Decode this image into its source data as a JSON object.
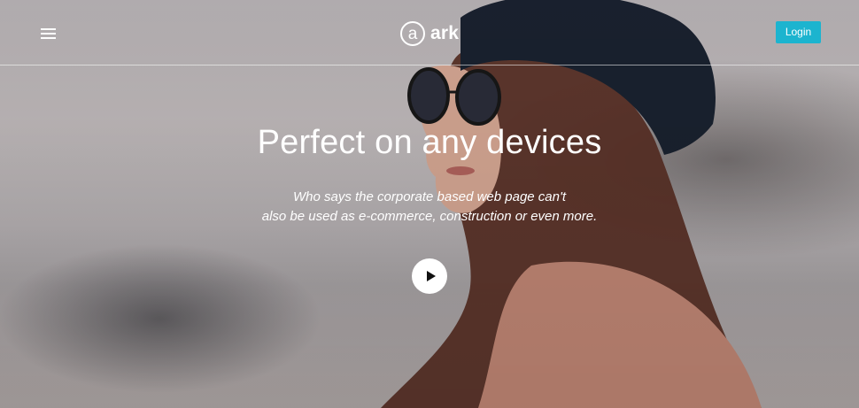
{
  "header": {
    "menu_icon": "hamburger-menu-icon",
    "logo": {
      "mark": "a",
      "text": "ark"
    },
    "login_label": "Login"
  },
  "hero": {
    "title": "Perfect on any devices",
    "subtitle_line1": "Who says the corporate based web page can't",
    "subtitle_line2": "also be used as e-commerce, construction or even more.",
    "play_icon": "play-icon"
  },
  "colors": {
    "accent": "#1cb4cf",
    "text": "#ffffff",
    "background": "#b9b4b7"
  }
}
